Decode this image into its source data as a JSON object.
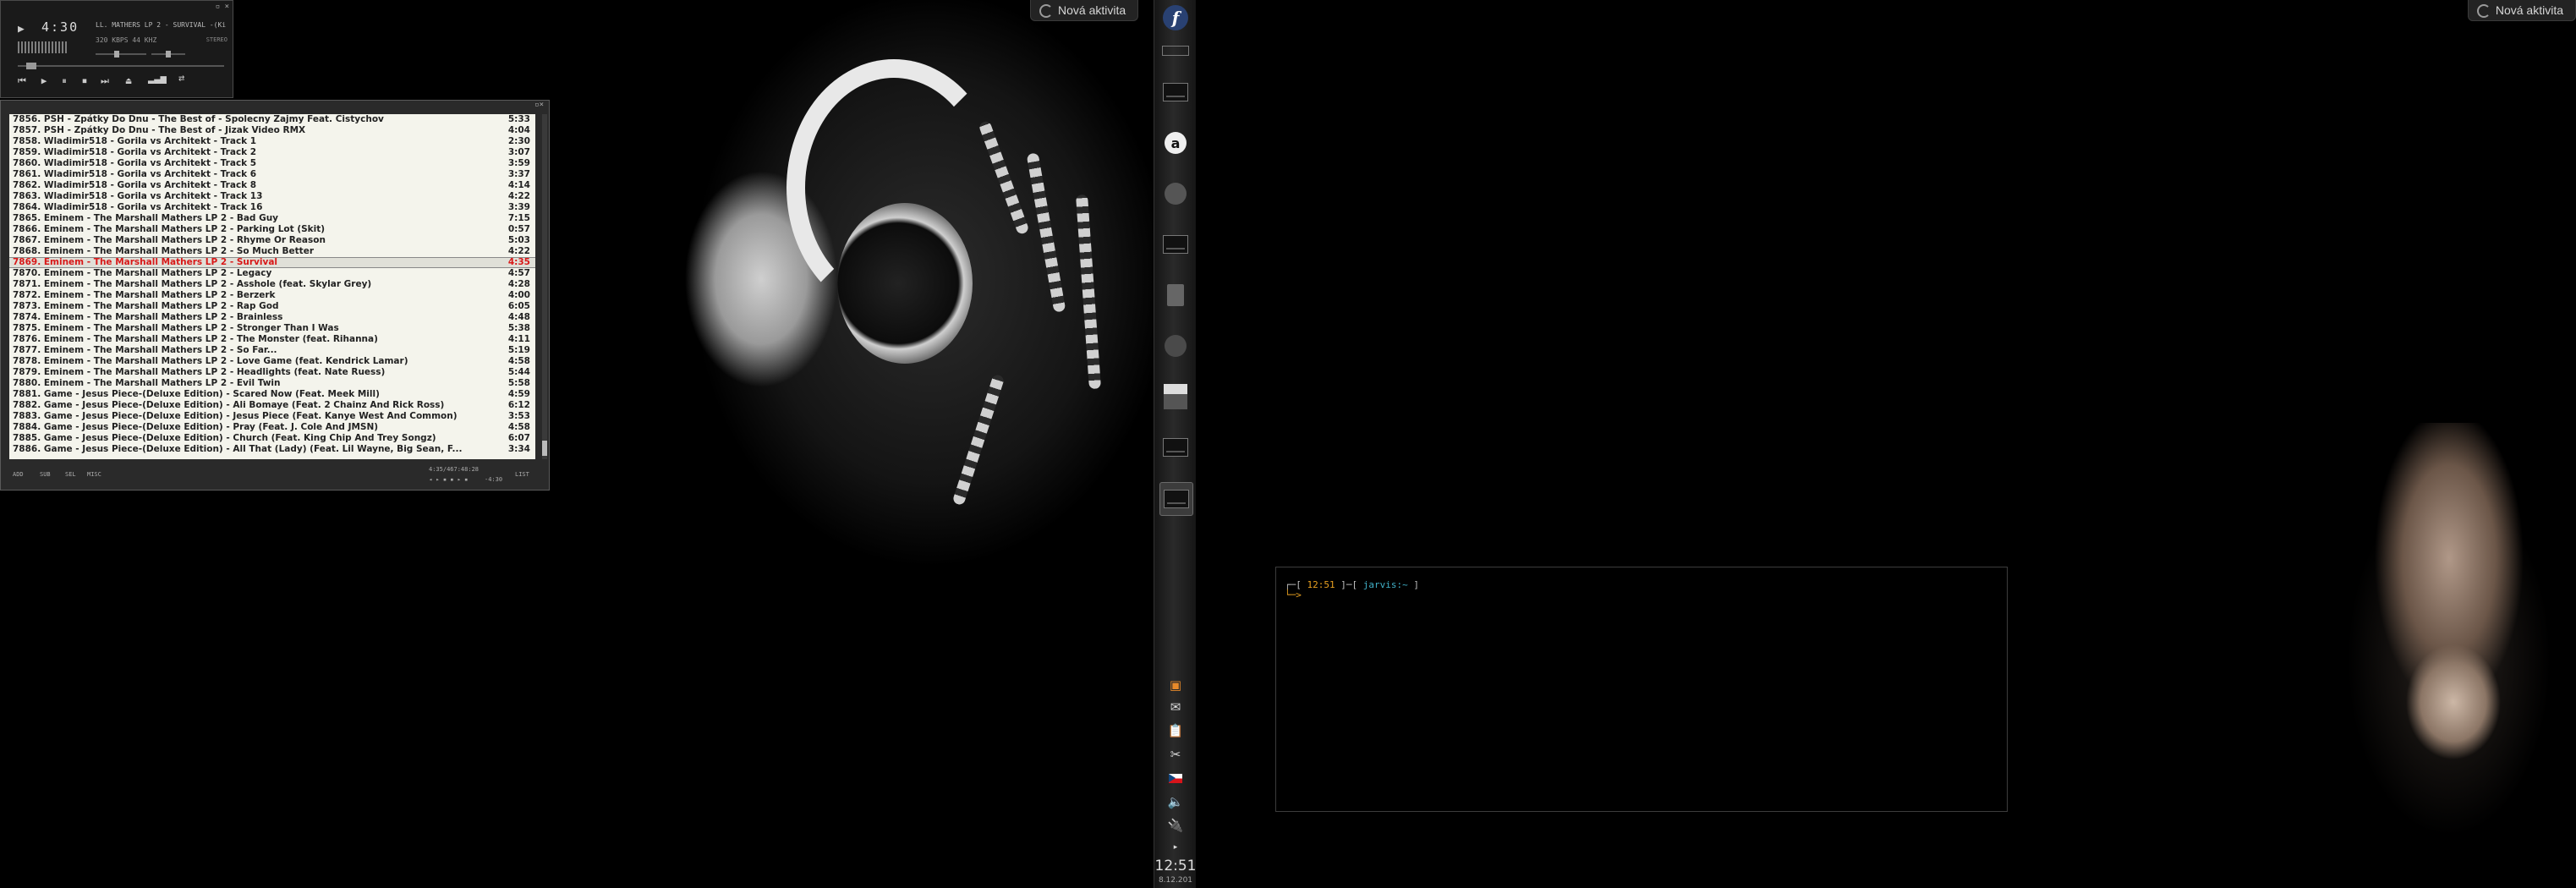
{
  "left_activity": {
    "label": "Nová aktivita",
    "icon": "activity-icon"
  },
  "right_activity": {
    "label": "Nová aktivita",
    "icon": "activity-icon"
  },
  "player": {
    "time": "4:30",
    "song": "LL. MATHERS LP 2 - SURVIVAL -(Ki",
    "bitrate": "320 KBPS",
    "samplerate": "44 KHZ",
    "stereo": "STEREO",
    "buttons": [
      "previous",
      "play",
      "pause",
      "stop",
      "next",
      "eject",
      "equalizer",
      "repeat"
    ]
  },
  "playlist": {
    "rows": [
      {
        "title": "7856. PSH - Zpátky Do Dnu - The Best of - Spolecny Zajmy Feat. Cistychov",
        "duration": "5:33"
      },
      {
        "title": "7857. PSH - Zpátky Do Dnu - The Best of - Jizak Video RMX",
        "duration": "4:04"
      },
      {
        "title": "7858. Wladimir518 - Gorila vs Architekt - Track 1",
        "duration": "2:30"
      },
      {
        "title": "7859. Wladimir518 - Gorila vs Architekt - Track 2",
        "duration": "3:07"
      },
      {
        "title": "7860. Wladimir518 - Gorila vs Architekt - Track 5",
        "duration": "3:59"
      },
      {
        "title": "7861. Wladimir518 - Gorila vs Architekt - Track 6",
        "duration": "3:37"
      },
      {
        "title": "7862. Wladimir518 - Gorila vs Architekt - Track 8",
        "duration": "4:14"
      },
      {
        "title": "7863. Wladimir518 - Gorila vs Architekt - Track 13",
        "duration": "4:22"
      },
      {
        "title": "7864. Wladimir518 - Gorila vs Architekt - Track 16",
        "duration": "3:39"
      },
      {
        "title": "7865. Eminem - The Marshall Mathers LP 2 - Bad Guy",
        "duration": "7:15"
      },
      {
        "title": "7866. Eminem - The Marshall Mathers LP 2 - Parking Lot (Skit)",
        "duration": "0:57"
      },
      {
        "title": "7867. Eminem - The Marshall Mathers LP 2 - Rhyme Or Reason",
        "duration": "5:03"
      },
      {
        "title": "7868. Eminem - The Marshall Mathers LP 2 - So Much Better",
        "duration": "4:22"
      },
      {
        "title": "7869. Eminem - The Marshall Mathers LP 2 - Survival",
        "duration": "4:35",
        "current": true
      },
      {
        "title": "7870. Eminem - The Marshall Mathers LP 2 - Legacy",
        "duration": "4:57"
      },
      {
        "title": "7871. Eminem - The Marshall Mathers LP 2 - Asshole (feat. Skylar Grey)",
        "duration": "4:28"
      },
      {
        "title": "7872. Eminem - The Marshall Mathers LP 2 - Berzerk",
        "duration": "4:00"
      },
      {
        "title": "7873. Eminem - The Marshall Mathers LP 2 - Rap God",
        "duration": "6:05"
      },
      {
        "title": "7874. Eminem - The Marshall Mathers LP 2 - Brainless",
        "duration": "4:48"
      },
      {
        "title": "7875. Eminem - The Marshall Mathers LP 2 - Stronger Than I Was",
        "duration": "5:38"
      },
      {
        "title": "7876. Eminem - The Marshall Mathers LP 2 - The Monster (feat. Rihanna)",
        "duration": "4:11"
      },
      {
        "title": "7877. Eminem - The Marshall Mathers LP 2 - So Far...",
        "duration": "5:19"
      },
      {
        "title": "7878. Eminem - The Marshall Mathers LP 2 - Love Game (feat. Kendrick Lamar)",
        "duration": "4:58"
      },
      {
        "title": "7879. Eminem - The Marshall Mathers LP 2 - Headlights (feat. Nate Ruess)",
        "duration": "5:44"
      },
      {
        "title": "7880. Eminem - The Marshall Mathers LP 2 - Evil Twin",
        "duration": "5:58"
      },
      {
        "title": "7881. Game - Jesus Piece-(Deluxe Edition) - Scared Now (Feat. Meek Mill)",
        "duration": "4:59"
      },
      {
        "title": "7882. Game - Jesus Piece-(Deluxe Edition) - Ali Bomaye (Feat. 2 Chainz And Rick Ross)",
        "duration": "6:12"
      },
      {
        "title": "7883. Game - Jesus Piece-(Deluxe Edition) - Jesus Piece (Feat. Kanye West And Common)",
        "duration": "3:53"
      },
      {
        "title": "7884. Game - Jesus Piece-(Deluxe Edition) - Pray (Feat. J. Cole And JMSN)",
        "duration": "4:58"
      },
      {
        "title": "7885. Game - Jesus Piece-(Deluxe Edition) - Church (Feat. King Chip And Trey Songz)",
        "duration": "6:07"
      },
      {
        "title": "7886. Game - Jesus Piece-(Deluxe Edition) - All That (Lady) (Feat. Lil Wayne, Big Sean, F...",
        "duration": "3:34"
      }
    ],
    "footer": {
      "add": "ADD",
      "sub": "SUB",
      "sel": "SEL",
      "misc": "MISC",
      "time_info": "4:35/467:48:28",
      "elapsed": "-4:30",
      "list": "LIST"
    }
  },
  "taskbar": {
    "clock": "12:51",
    "date": "8.12.201",
    "colors": {
      "fedora": "#294172"
    }
  },
  "terminal": {
    "time": "12:51",
    "host": "jarvis:~",
    "open_bracket": "┌─[",
    "mid_bracket": "]─[",
    "close_bracket": "]",
    "second_line": "└─>"
  }
}
